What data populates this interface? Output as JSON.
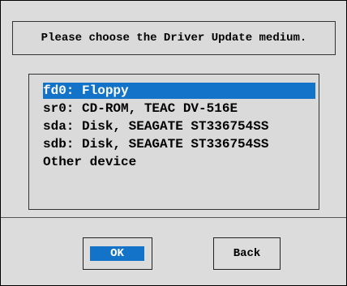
{
  "dialog": {
    "title": "Please choose the Driver Update medium."
  },
  "devices": {
    "selected_index": 0,
    "items": [
      {
        "label": "fd0: Floppy"
      },
      {
        "label": "sr0: CD-ROM, TEAC DV-516E"
      },
      {
        "label": "sda: Disk, SEAGATE ST336754SS"
      },
      {
        "label": "sdb: Disk, SEAGATE ST336754SS"
      },
      {
        "label": "Other device"
      }
    ]
  },
  "buttons": {
    "ok_label": "OK",
    "back_label": "Back"
  },
  "colors": {
    "selection": "#1273c9",
    "selection_text": "#ffffff",
    "background": "#dcdcdc"
  }
}
